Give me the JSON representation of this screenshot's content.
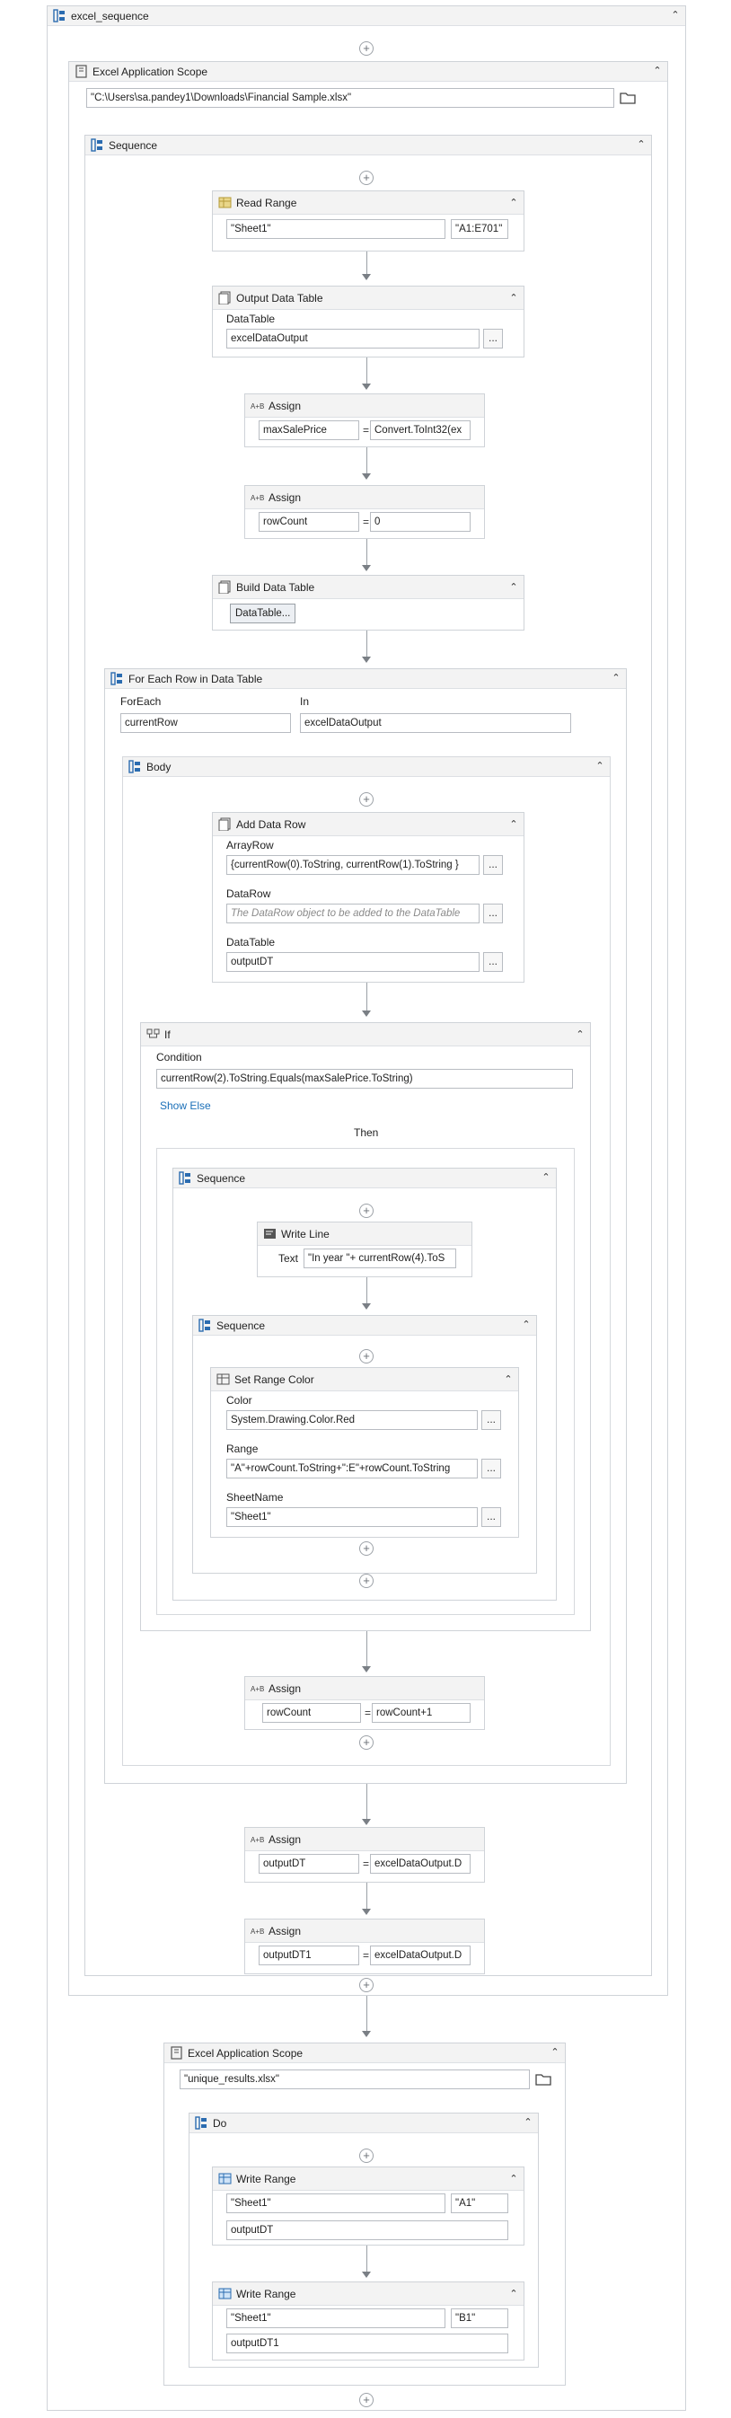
{
  "root": {
    "title": "excel_sequence"
  },
  "scope1": {
    "title": "Excel Application Scope",
    "path": "\"C:\\Users\\sa.pandey1\\Downloads\\Financial Sample.xlsx\""
  },
  "seq1": {
    "title": "Sequence"
  },
  "readRange": {
    "title": "Read Range",
    "sheet": "\"Sheet1\"",
    "range": "\"A1:E701\""
  },
  "outputDT": {
    "title": "Output Data Table",
    "dt_label": "DataTable",
    "dt_value": "excelDataOutput",
    "more": "..."
  },
  "assign1": {
    "title": "Assign",
    "to": "maxSalePrice",
    "eq": "=",
    "value": "Convert.ToInt32(ex"
  },
  "assign2": {
    "title": "Assign",
    "to": "rowCount",
    "eq": "=",
    "value": "0"
  },
  "buildDT": {
    "title": "Build Data Table",
    "button": "DataTable..."
  },
  "forEach": {
    "title": "For Each Row in Data Table",
    "foreach_label": "ForEach",
    "foreach_value": "currentRow",
    "in_label": "In",
    "in_value": "excelDataOutput"
  },
  "body": {
    "title": "Body"
  },
  "addRow": {
    "title": "Add Data Row",
    "array_label": "ArrayRow",
    "array_value": "{currentRow(0).ToString, currentRow(1).ToString  }",
    "datarow_label": "DataRow",
    "datarow_placeholder": "The DataRow object to be added to the DataTable",
    "dt_label": "DataTable",
    "dt_value": "outputDT",
    "more": "..."
  },
  "ifAct": {
    "title": "If",
    "cond_label": "Condition",
    "cond_value": "currentRow(2).ToString.Equals(maxSalePrice.ToString)",
    "show_else": "Show Else",
    "then": "Then"
  },
  "seqThen": {
    "title": "Sequence"
  },
  "writeLine": {
    "title": "Write Line",
    "text_label": "Text",
    "text_value": "\"In year \"+ currentRow(4).ToS"
  },
  "seqInner": {
    "title": "Sequence"
  },
  "setColor": {
    "title": "Set Range Color",
    "color_label": "Color",
    "color_value": "System.Drawing.Color.Red",
    "range_label": "Range",
    "range_value": "\"A\"+rowCount.ToString+\":E\"+rowCount.ToString",
    "sheet_label": "SheetName",
    "sheet_value": "\"Sheet1\"",
    "more": "..."
  },
  "assign3": {
    "title": "Assign",
    "to": "rowCount",
    "eq": "=",
    "value": "rowCount+1"
  },
  "assign4": {
    "title": "Assign",
    "to": "outputDT",
    "eq": "=",
    "value": "excelDataOutput.D"
  },
  "assign5": {
    "title": "Assign",
    "to": "outputDT1",
    "eq": "=",
    "value": "excelDataOutput.D"
  },
  "scope2": {
    "title": "Excel Application Scope",
    "path": "\"unique_results.xlsx\""
  },
  "doSeq": {
    "title": "Do"
  },
  "write1": {
    "title": "Write Range",
    "sheet": "\"Sheet1\"",
    "cell": "\"A1\"",
    "dt": "outputDT"
  },
  "write2": {
    "title": "Write Range",
    "sheet": "\"Sheet1\"",
    "cell": "\"B1\"",
    "dt": "outputDT1"
  },
  "icons": {
    "collapse": "chevron-up-icon",
    "add": "plus-icon",
    "folder": "folder-icon"
  },
  "colors": {
    "header_bg": "#f3f3f3",
    "border": "#cfd3d8",
    "link": "#1a6fb8",
    "sequence_icon": "#2b6cb0"
  }
}
